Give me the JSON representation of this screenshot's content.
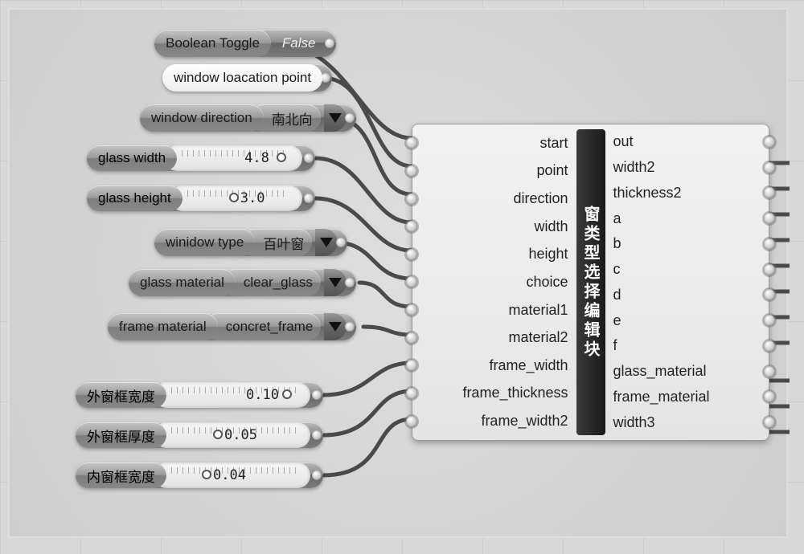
{
  "boolean_toggle": {
    "label": "Boolean Toggle",
    "value": "False"
  },
  "window_location_point": {
    "label": "window loacation point"
  },
  "window_direction": {
    "label": "window direction",
    "value": "南北向"
  },
  "glass_width": {
    "label": "glass width",
    "value": "4.8"
  },
  "glass_height": {
    "label": "glass height",
    "value": "3.0"
  },
  "window_type": {
    "label": "winidow type",
    "value": "百叶窗"
  },
  "glass_material": {
    "label": "glass material",
    "value": "clear_glass"
  },
  "frame_material": {
    "label": "frame material",
    "value": "concret_frame"
  },
  "outer_frame_width": {
    "label": "外窗框宽度",
    "value": "0.10"
  },
  "outer_frame_thickness": {
    "label": "外窗框厚度",
    "value": "0.05"
  },
  "inner_frame_width": {
    "label": "内窗框宽度",
    "value": "0.04"
  },
  "cluster": {
    "title": "窗类型选择编辑块",
    "inputs": [
      "start",
      "point",
      "direction",
      "width",
      "height",
      "choice",
      "material1",
      "material2",
      "frame_width",
      "frame_thickness",
      "frame_width2"
    ],
    "outputs": [
      "out",
      "width2",
      "thickness2",
      "a",
      "b",
      "c",
      "d",
      "e",
      "f",
      "glass_material",
      "frame_material",
      "width3"
    ]
  },
  "chart_data": {
    "type": "table",
    "title": "窗类型选择编辑块 — input parameter values",
    "rows": [
      {
        "param": "start (Boolean Toggle)",
        "value": "False"
      },
      {
        "param": "point (window loacation point)",
        "value": ""
      },
      {
        "param": "direction (window direction)",
        "value": "南北向"
      },
      {
        "param": "width (glass width)",
        "value": 4.8
      },
      {
        "param": "height (glass height)",
        "value": 3.0
      },
      {
        "param": "choice (winidow type)",
        "value": "百叶窗"
      },
      {
        "param": "material1 (glass material)",
        "value": "clear_glass"
      },
      {
        "param": "material2 (frame material)",
        "value": "concret_frame"
      },
      {
        "param": "frame_width (外窗框宽度)",
        "value": 0.1
      },
      {
        "param": "frame_thickness (外窗框厚度)",
        "value": 0.05
      },
      {
        "param": "frame_width2 (内窗框宽度)",
        "value": 0.04
      }
    ],
    "outputs": [
      "out",
      "width2",
      "thickness2",
      "a",
      "b",
      "c",
      "d",
      "e",
      "f",
      "glass_material",
      "frame_material",
      "width3"
    ]
  }
}
